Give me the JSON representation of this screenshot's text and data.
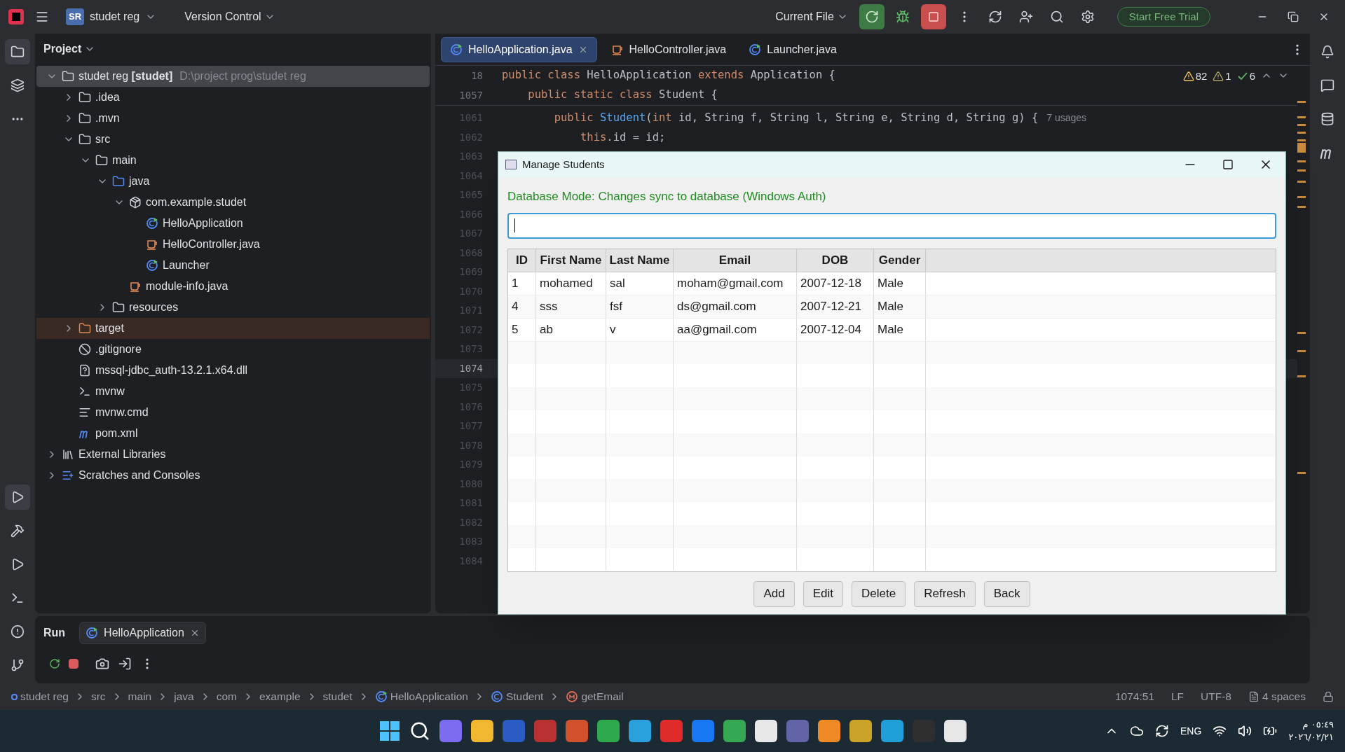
{
  "title_bar": {
    "project_badge": "SR",
    "project": "studet reg",
    "vcs": "Version Control",
    "run_config": "Current File",
    "trial_button": "Start Free Trial"
  },
  "project_panel": {
    "title": "Project",
    "tree": [
      {
        "label": "studet reg **[studet]**",
        "path": "D:\\project prog\\studet reg",
        "kind": "module",
        "selected": true,
        "expanded": true,
        "children": [
          {
            "label": ".idea",
            "kind": "folder",
            "selected": false,
            "expanded": false
          },
          {
            "label": ".mvn",
            "kind": "folder",
            "selected": false,
            "expanded": false
          },
          {
            "label": "src",
            "kind": "folder",
            "selected": false,
            "expanded": true,
            "children": [
              {
                "label": "main",
                "kind": "folder",
                "selected": false,
                "expanded": true,
                "children": [
                  {
                    "label": "java",
                    "kind": "source",
                    "selected": false,
                    "expanded": true,
                    "children": [
                      {
                        "label": "com.example.studet",
                        "kind": "package",
                        "selected": false,
                        "expanded": true,
                        "children": [
                          {
                            "label": "HelloApplication",
                            "kind": "runnable",
                            "selected": false
                          },
                          {
                            "label": "HelloController.java",
                            "kind": "java",
                            "selected": false
                          },
                          {
                            "label": "Launcher",
                            "kind": "runnable",
                            "selected": false
                          }
                        ]
                      },
                      {
                        "label": "module-info.java",
                        "kind": "java",
                        "selected": false
                      }
                    ]
                  },
                  {
                    "label": "resources",
                    "kind": "resources",
                    "selected": false,
                    "expanded": false
                  }
                ]
              }
            ]
          },
          {
            "label": "target",
            "kind": "excluded",
            "selected": false,
            "expanded": false
          },
          {
            "label": ".gitignore",
            "kind": "ignore",
            "selected": false
          },
          {
            "label": "mssql-jdbc_auth-13.2.1.x64.dll",
            "kind": "unknown",
            "selected": false
          },
          {
            "label": "mvnw",
            "kind": "script",
            "selected": false
          },
          {
            "label": "mvnw.cmd",
            "kind": "text",
            "selected": false
          },
          {
            "label": "pom.xml",
            "kind": "maven",
            "selected": false
          }
        ]
      },
      {
        "label": "External Libraries",
        "kind": "libraries",
        "selected": false,
        "expanded": false
      },
      {
        "label": "Scratches and Consoles",
        "kind": "scratches",
        "selected": false,
        "expanded": false
      }
    ]
  },
  "editor": {
    "tabs": [
      {
        "label": "HelloApplication.java",
        "kind": "runnable",
        "selected": true
      },
      {
        "label": "HelloController.java",
        "kind": "java",
        "selected": false
      },
      {
        "label": "Launcher.java",
        "kind": "runnable",
        "selected": false
      }
    ],
    "inspections": {
      "warnings": "82",
      "weak_warnings": "1",
      "typos": "6"
    },
    "sticky_lines": [
      {
        "number": "18",
        "tokens": [
          {
            "text": "public class ",
            "kind": "keyword"
          },
          {
            "text": "HelloApplication ",
            "kind": "plain"
          },
          {
            "text": "extends ",
            "kind": "keyword"
          },
          {
            "text": "Application {",
            "kind": "plain"
          }
        ]
      },
      {
        "number": "1057",
        "tokens": [
          {
            "text": "    public static class ",
            "kind": "keyword"
          },
          {
            "text": "Student {",
            "kind": "plain"
          }
        ]
      }
    ],
    "lines": [
      {
        "number": "1061",
        "tokens": [
          {
            "text": "        public ",
            "kind": "keyword"
          },
          {
            "text": "Student",
            "kind": "method"
          },
          {
            "text": "(",
            "kind": "plain"
          },
          {
            "text": "int ",
            "kind": "keyword"
          },
          {
            "text": "id, String f, String l, String e, String d, String g) {",
            "kind": "plain"
          },
          {
            "text": "7 usages",
            "kind": "hint"
          }
        ]
      },
      {
        "number": "1062",
        "tokens": [
          {
            "text": "            this",
            "kind": "keyword"
          },
          {
            "text": ".id = id;",
            "kind": "plain"
          }
        ]
      },
      {
        "number": "1063"
      },
      {
        "number": "1064"
      },
      {
        "number": "1065"
      },
      {
        "number": "1066"
      },
      {
        "number": "1067"
      },
      {
        "number": "1068"
      },
      {
        "number": "1069"
      },
      {
        "number": "1070"
      },
      {
        "number": "1071"
      },
      {
        "number": "1072"
      },
      {
        "number": "1073"
      },
      {
        "number": "1074",
        "selected": true
      },
      {
        "number": "1075"
      },
      {
        "number": "1076"
      },
      {
        "number": "1077"
      },
      {
        "number": "1078"
      },
      {
        "number": "1079"
      },
      {
        "number": "1080"
      },
      {
        "number": "1081"
      },
      {
        "number": "1082"
      },
      {
        "number": "1083"
      },
      {
        "number": "1084"
      }
    ]
  },
  "dialog": {
    "title": "Manage Students",
    "mode_text": "Database Mode: Changes sync to database (Windows Auth)",
    "table": {
      "columns": [
        "ID",
        "First Name",
        "Last Name",
        "Email",
        "DOB",
        "Gender"
      ],
      "rows": [
        [
          "1",
          "mohamed",
          "sal",
          "moham@gmail.com",
          "2007-12-18",
          "Male"
        ],
        [
          "4",
          "sss",
          "fsf",
          "ds@gmail.com",
          "2007-12-21",
          "Male"
        ],
        [
          "5",
          "ab",
          "v",
          "aa@gmail.com",
          "2007-12-04",
          "Male"
        ]
      ]
    },
    "buttons": [
      "Add",
      "Edit",
      "Delete",
      "Refresh",
      "Back"
    ]
  },
  "run_panel": {
    "title": "Run",
    "tab": "HelloApplication"
  },
  "status_bar": {
    "breadcrumbs": [
      {
        "label": "studet reg",
        "kind": "module"
      },
      {
        "label": "src",
        "kind": "plain"
      },
      {
        "label": "main",
        "kind": "plain"
      },
      {
        "label": "java",
        "kind": "plain"
      },
      {
        "label": "com",
        "kind": "plain"
      },
      {
        "label": "example",
        "kind": "plain"
      },
      {
        "label": "studet",
        "kind": "plain"
      },
      {
        "label": "HelloApplication",
        "kind": "runnable"
      },
      {
        "label": "Student",
        "kind": "class"
      },
      {
        "label": "getEmail",
        "kind": "method"
      }
    ],
    "position": "1074:51",
    "line_separator": "LF",
    "encoding": "UTF-8",
    "indent": "4 spaces"
  },
  "taskbar": {
    "language": "ENG",
    "time": "٠٥:٤٩ م",
    "date": "٢٠٢٦/٠٢/٢١"
  }
}
